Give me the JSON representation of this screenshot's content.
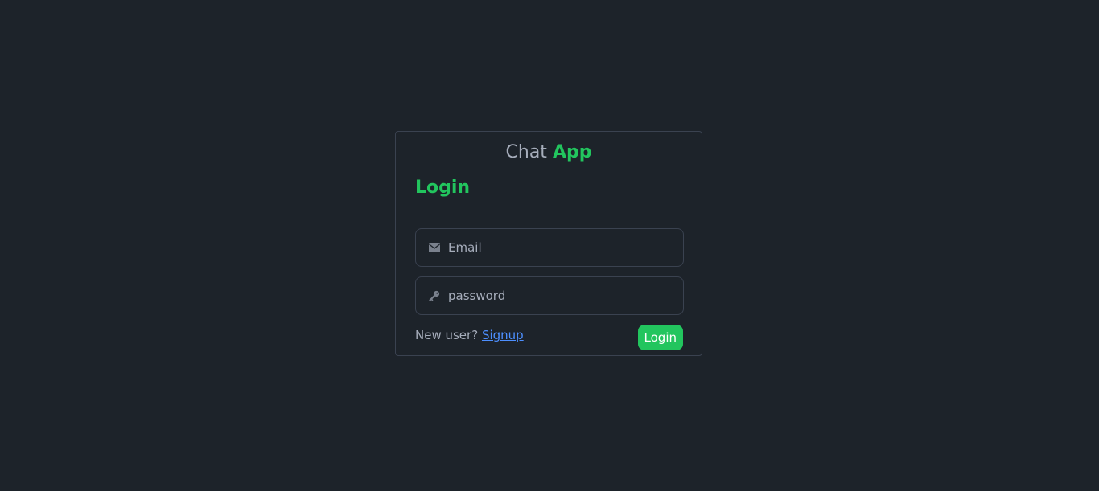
{
  "brand": {
    "prefix": "Chat",
    "accent": "App"
  },
  "form": {
    "heading": "Login",
    "email": {
      "icon": "envelope-icon",
      "placeholder": "Email",
      "value": ""
    },
    "password": {
      "icon": "key-icon",
      "placeholder": "password",
      "value": ""
    },
    "signup_prompt": "New user?",
    "signup_link": "Signup",
    "submit_label": "Login"
  },
  "colors": {
    "background": "#1d232a",
    "accent": "#22c55e",
    "text": "#a6adbb",
    "link": "#4d8fff",
    "border": "#3a4250"
  }
}
